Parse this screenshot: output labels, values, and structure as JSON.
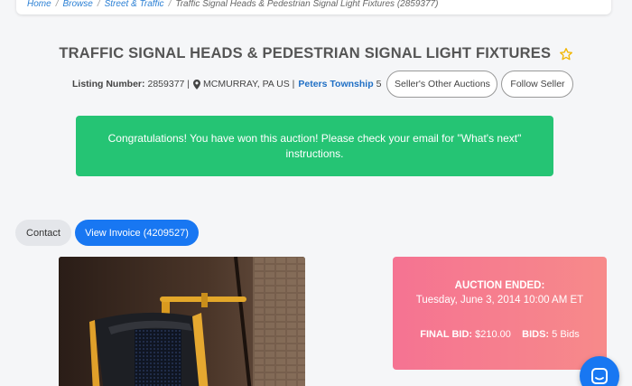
{
  "breadcrumb": {
    "items": [
      "Home",
      "Browse",
      "Street & Traffic"
    ],
    "current": "Traffic Signal Heads & Pedestrian Signal Light Fixtures (2859377)"
  },
  "listing": {
    "title": "TRAFFIC SIGNAL HEADS & PEDESTRIAN SIGNAL LIGHT FIXTURES",
    "number_label": "Listing Number:",
    "number": "2859377 |",
    "location": "MCMURRAY, PA US |",
    "seller": "Peters Township",
    "seller_suffix": "5"
  },
  "buttons": {
    "other_auctions": "Seller's Other Auctions",
    "follow": "Follow Seller",
    "contact": "Contact",
    "view_invoice": "View Invoice (4209527)"
  },
  "banner": {
    "message": "Congratulations! You have won this auction! Please check your email for \"What's next\" instructions."
  },
  "auction": {
    "status": "AUCTION ENDED:",
    "date": "Tuesday, June 3, 2014 10:00 AM ET",
    "final_bid_label": "FINAL BID:",
    "final_bid": "$210.00",
    "bids_label": "BIDS:",
    "bids": "5 Bids"
  },
  "colors": {
    "success": "#25c474",
    "primary": "#1877f2",
    "card_gradient_start": "#f57392",
    "card_gradient_end": "#f78a8a",
    "star": "#f2b600"
  }
}
